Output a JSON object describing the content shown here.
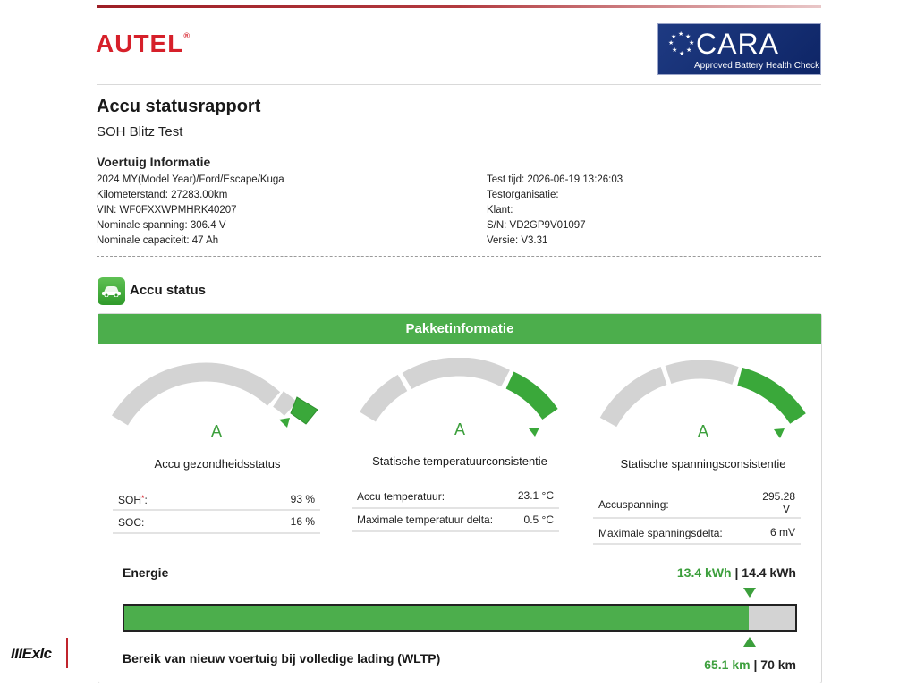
{
  "header": {
    "brand": "AUTEL",
    "brand_mark": "®",
    "cert_name": "CARA",
    "cert_sub": "Approved Battery Health Check"
  },
  "report": {
    "title": "Accu statusrapport",
    "subtitle": "SOH Blitz Test"
  },
  "vehicle": {
    "title": "Voertuig Informatie",
    "left": [
      "2024 MY(Model Year)/Ford/Escape/Kuga",
      "Kilometerstand: 27283.00km",
      "VIN: WF0FXXWPMHRK40207",
      "Nominale spanning: 306.4 V",
      "Nominale capaciteit: 47 Ah"
    ],
    "right": [
      "Test tijd: 2026-06-19 13:26:03",
      "Testorganisatie:",
      "Klant:",
      "S/N: VD2GP9V01097",
      "Versie: V3.31"
    ]
  },
  "status": {
    "title": "Accu status",
    "panel_title": "Pakketinformatie",
    "gauges": [
      {
        "grade": "A",
        "label": "Accu gezondheidsstatus",
        "rows": [
          {
            "k": "SOH",
            "k_mark": "*",
            "k_suffix": ":",
            "v": "93 %"
          },
          {
            "k": "SOC:",
            "k_mark": "",
            "k_suffix": "",
            "v": "16 %"
          }
        ]
      },
      {
        "grade": "A",
        "label": "Statische temperatuurconsistentie",
        "rows": [
          {
            "k": "Accu temperatuur:",
            "k_mark": "",
            "k_suffix": "",
            "v": "23.1 °C"
          },
          {
            "k": "Maximale temperatuur delta:",
            "k_mark": "",
            "k_suffix": "",
            "v": "0.5 °C"
          }
        ]
      },
      {
        "grade": "A",
        "label": "Statische spanningsconsistentie",
        "rows": [
          {
            "k": "Accuspanning:",
            "k_mark": "",
            "k_suffix": "",
            "v1": "295.28",
            "v2": "V"
          },
          {
            "k": "Maximale spanningsdelta:",
            "k_mark": "",
            "k_suffix": "",
            "v": "6 mV"
          }
        ]
      }
    ]
  },
  "energy": {
    "label": "Energie",
    "current": "13.4 kWh",
    "separator": " | ",
    "total": "14.4 kWh",
    "fill_fraction": 0.93,
    "range_label": "Bereik van nieuw voertuig bij volledige lading (WLTP)",
    "range_current": "65.1 km",
    "range_total": "70 km"
  },
  "watermark": "IIIExlc",
  "colors": {
    "accent_green": "#4cae4c",
    "brand_red": "#d6202a",
    "gauge_grey": "#d3d3d3"
  }
}
